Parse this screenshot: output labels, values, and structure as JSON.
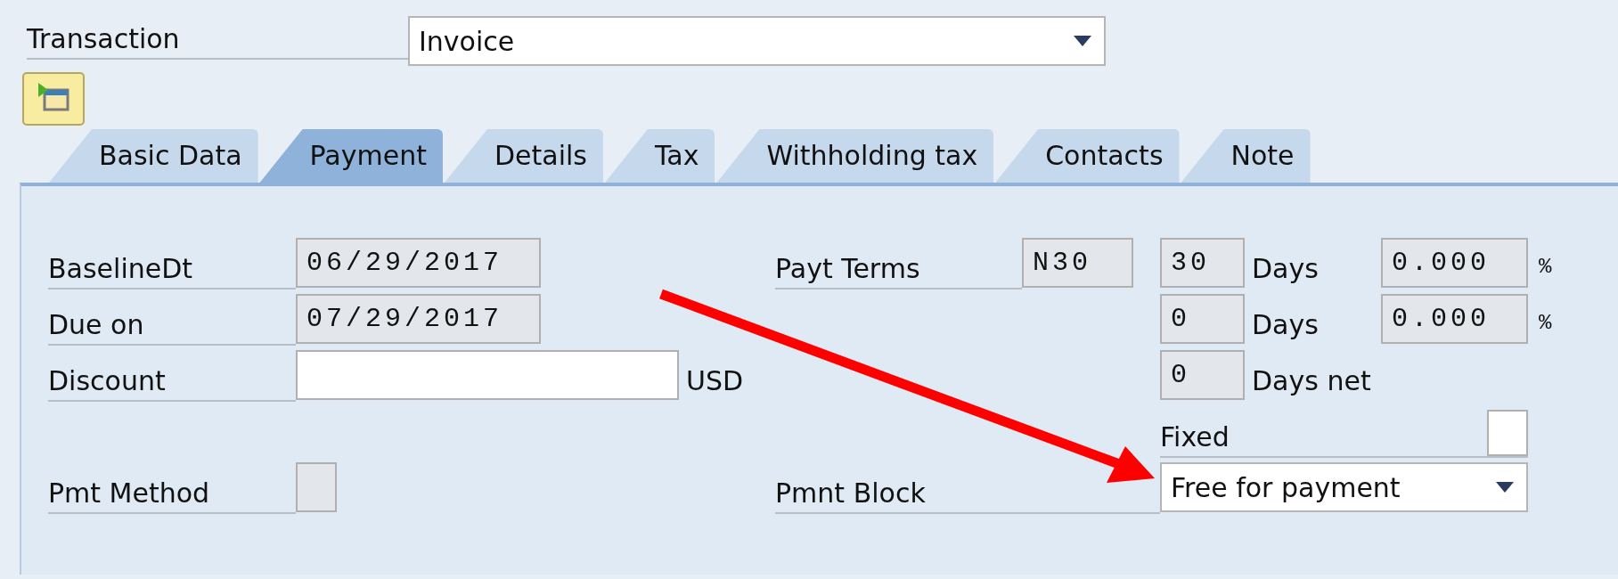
{
  "transaction": {
    "label": "Transaction",
    "value": "Invoice"
  },
  "tabs": [
    {
      "label": "Basic Data",
      "selected": false
    },
    {
      "label": "Payment",
      "selected": true
    },
    {
      "label": "Details",
      "selected": false
    },
    {
      "label": "Tax",
      "selected": false
    },
    {
      "label": "Withholding tax",
      "selected": false
    },
    {
      "label": "Contacts",
      "selected": false
    },
    {
      "label": "Note",
      "selected": false
    }
  ],
  "left_fields": [
    {
      "label": "BaselineDt",
      "kind": "readonly",
      "value": "06/29/2017"
    },
    {
      "label": "Due on",
      "kind": "readonly",
      "value": "07/29/2017"
    },
    {
      "label": "Discount",
      "kind": "input",
      "unit": "USD"
    },
    {
      "label": "Pmt Method",
      "kind": "box"
    }
  ],
  "payt_terms": {
    "label": "Payt Terms",
    "value": "N30"
  },
  "terms": [
    {
      "days": "30",
      "unit": "Days",
      "percent": "0.000",
      "percent_sign": "%"
    },
    {
      "days": "0",
      "unit": "Days",
      "percent": "0.000",
      "percent_sign": "%"
    },
    {
      "days": "0",
      "unit": "Days net"
    }
  ],
  "fixed": {
    "label": "Fixed",
    "checked": false
  },
  "pmnt_block": {
    "label": "Pmnt Block",
    "value": "Free for payment"
  }
}
